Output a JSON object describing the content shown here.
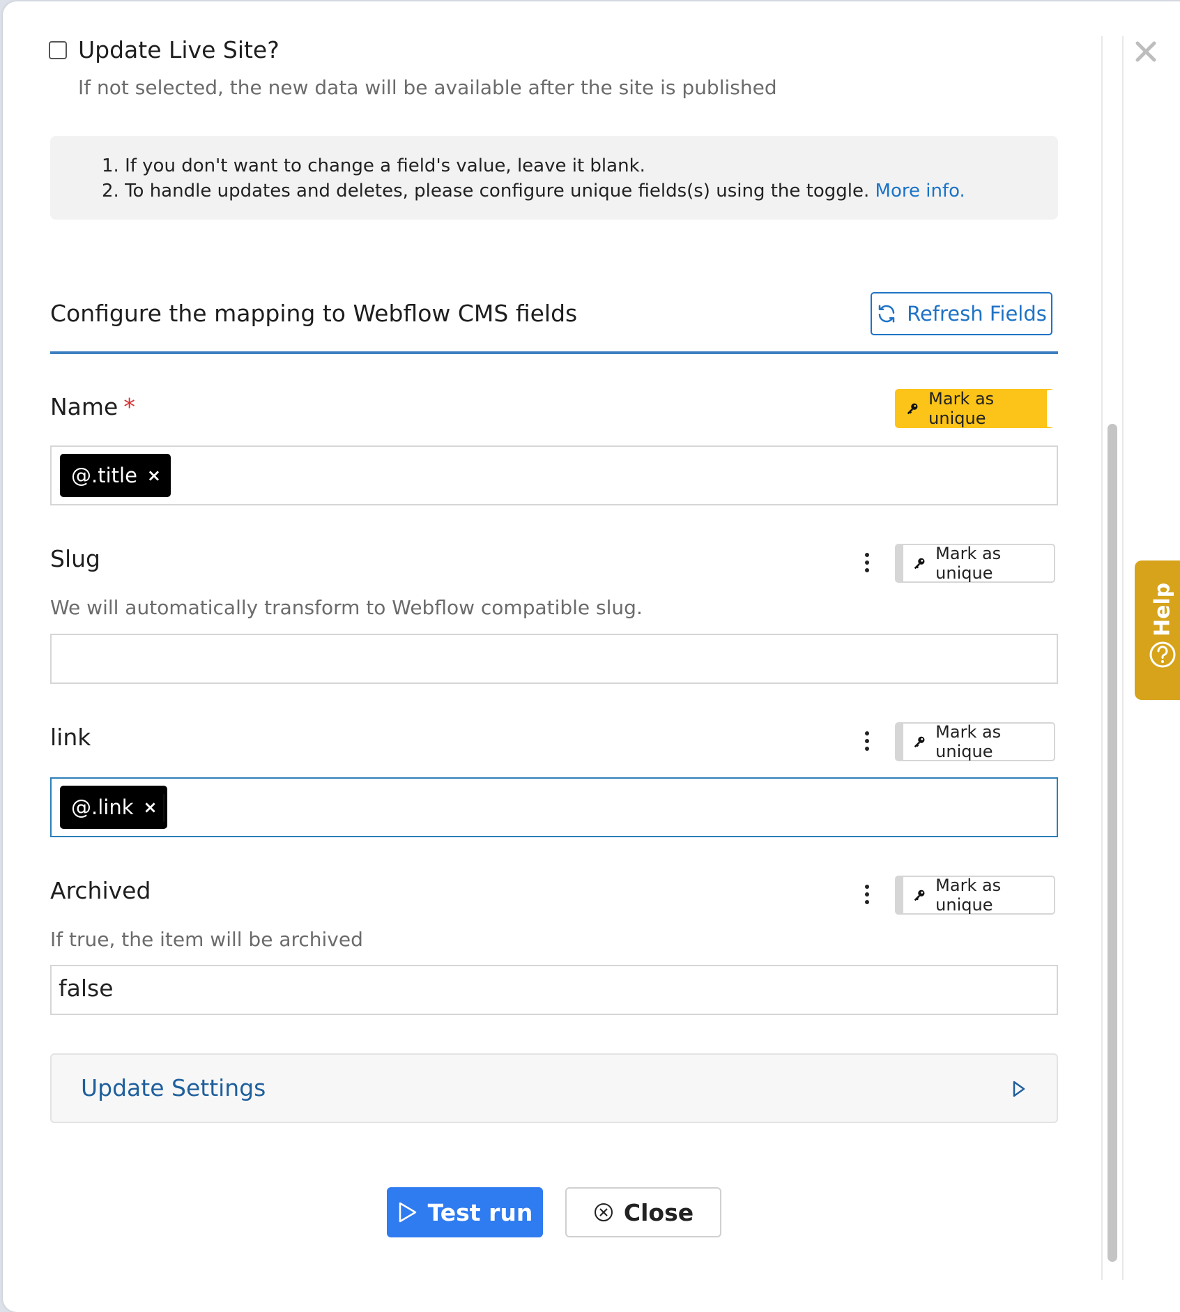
{
  "live_site": {
    "label": "Update Live Site?",
    "help": "If not selected, the new data will be available after the site is published",
    "checked": false
  },
  "notes": {
    "item1": "1. If you don't want to change a field's value, leave it blank.",
    "item2": "2. To handle updates and deletes, please configure unique fields(s) using the toggle.",
    "item2_link": "More info."
  },
  "mapping": {
    "title": "Configure the mapping to Webflow CMS fields",
    "refresh_label": "Refresh Fields"
  },
  "fields": {
    "name": {
      "label": "Name",
      "required_mark": "*",
      "chip": "@.title",
      "chip_remove": "×",
      "unique_label": "Mark as unique"
    },
    "slug": {
      "label": "Slug",
      "desc": "We will automatically transform to Webflow compatible slug.",
      "unique_label": "Mark as unique"
    },
    "link": {
      "label": "link",
      "chip": "@.link",
      "chip_remove": "×",
      "unique_label": "Mark as unique"
    },
    "archived": {
      "label": "Archived",
      "desc": "If true, the item will be archived",
      "value": "false",
      "unique_label": "Mark as unique"
    }
  },
  "update_settings": {
    "label": "Update Settings"
  },
  "footer": {
    "test_run": "Test run",
    "close": "Close"
  },
  "help_tab": {
    "label": "Help"
  },
  "colors": {
    "primary": "#2f7bf0",
    "link": "#1a73c8",
    "unique_active": "#fcc419",
    "help_tab": "#d6a31a"
  },
  "icons": [
    "close-icon",
    "refresh-icon",
    "key-icon",
    "kebab-icon",
    "play-icon",
    "circle-x-icon",
    "caret-right-icon",
    "question-circle-icon"
  ]
}
